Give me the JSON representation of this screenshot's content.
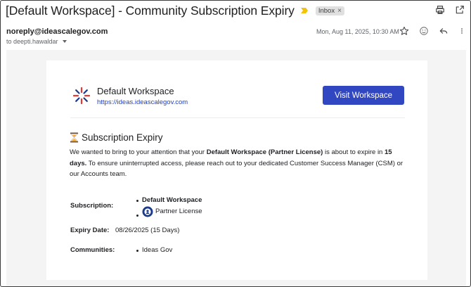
{
  "email": {
    "subject": "[Default Workspace] - Community Subscription Expiry",
    "label_chip": "Inbox",
    "label_close": "×",
    "sender": "noreply@ideascalegov.com",
    "to": "to deepti.hawaldar",
    "date": "Mon, Aug 11, 2025, 10:30 AM",
    "top_icons": [
      "print-icon",
      "open-new-window-icon"
    ],
    "message_icons": [
      "star-icon",
      "emoji-icon",
      "reply-icon",
      "more-vert-icon"
    ]
  },
  "workspace": {
    "name": "Default Workspace",
    "url": "https://ideas.ideascalegov.com",
    "visit_button": "Visit Workspace",
    "button_color": "#3147c2"
  },
  "notice": {
    "heading": "Subscription Expiry",
    "paragraph_parts": [
      "We wanted to bring to your attention that your ",
      "Default Workspace (Partner License)",
      " is about to expire in ",
      "15 days.",
      " To ensure uninterrupted access, please reach out to your dedicated Customer Success Manager (CSM) or our Accounts team."
    ]
  },
  "details": {
    "subscription_label": "Subscription:",
    "subscription_items": [
      "Default Workspace",
      "Partner License"
    ],
    "expiry_label": "Expiry Date:",
    "expiry_value": "08/26/2025 (15 Days)",
    "communities_label": "Communities:",
    "communities_items": [
      "Ideas Gov"
    ]
  }
}
